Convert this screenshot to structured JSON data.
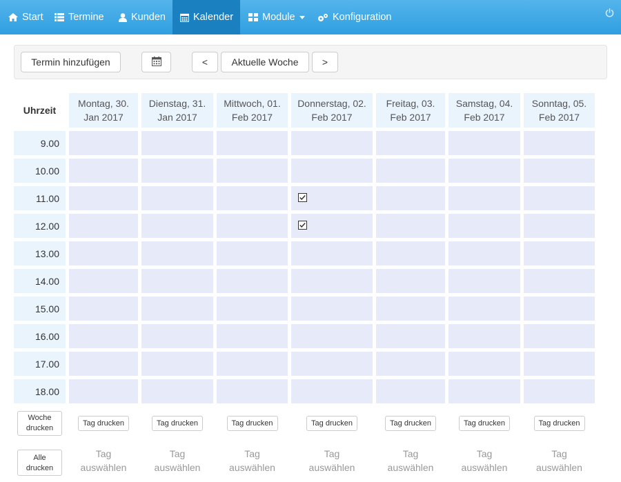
{
  "nav": {
    "items": [
      {
        "label": "Start",
        "icon": "home-icon",
        "active": false
      },
      {
        "label": "Termine",
        "icon": "list-icon",
        "active": false
      },
      {
        "label": "Kunden",
        "icon": "user-icon",
        "active": false
      },
      {
        "label": "Kalender",
        "icon": "calendar-icon",
        "active": true
      },
      {
        "label": "Module",
        "icon": "grid-icon",
        "active": false,
        "dropdown": true
      },
      {
        "label": "Konfiguration",
        "icon": "gears-icon",
        "active": false
      }
    ],
    "power_icon": "power-icon"
  },
  "toolbar": {
    "add_label": "Termin hinzufügen",
    "calendar_icon": "calendar-icon",
    "prev_label": "<",
    "current_label": "Aktuelle Woche",
    "next_label": ">"
  },
  "grid": {
    "time_header": "Uhrzeit",
    "days": [
      {
        "line1": "Montag, 30.",
        "line2": "Jan 2017"
      },
      {
        "line1": "Dienstag, 31.",
        "line2": "Jan 2017"
      },
      {
        "line1": "Mittwoch, 01.",
        "line2": "Feb 2017"
      },
      {
        "line1": "Donnerstag, 02.",
        "line2": "Feb 2017"
      },
      {
        "line1": "Freitag, 03.",
        "line2": "Feb 2017"
      },
      {
        "line1": "Samstag, 04.",
        "line2": "Feb 2017"
      },
      {
        "line1": "Sonntag, 05.",
        "line2": "Feb 2017"
      }
    ],
    "times": [
      "9.00",
      "10.00",
      "11.00",
      "12.00",
      "13.00",
      "14.00",
      "15.00",
      "16.00",
      "17.00",
      "18.00"
    ],
    "booked": [
      {
        "day": 3,
        "time": 2
      },
      {
        "day": 3,
        "time": 3
      }
    ]
  },
  "bottom": {
    "print_week_line1": "Woche",
    "print_week_line2": "drucken",
    "print_day_label": "Tag drucken",
    "select_all_line1": "Alle",
    "select_all_line2": "drucken",
    "select_day_line1": "Tag",
    "select_day_line2": "auswählen"
  }
}
